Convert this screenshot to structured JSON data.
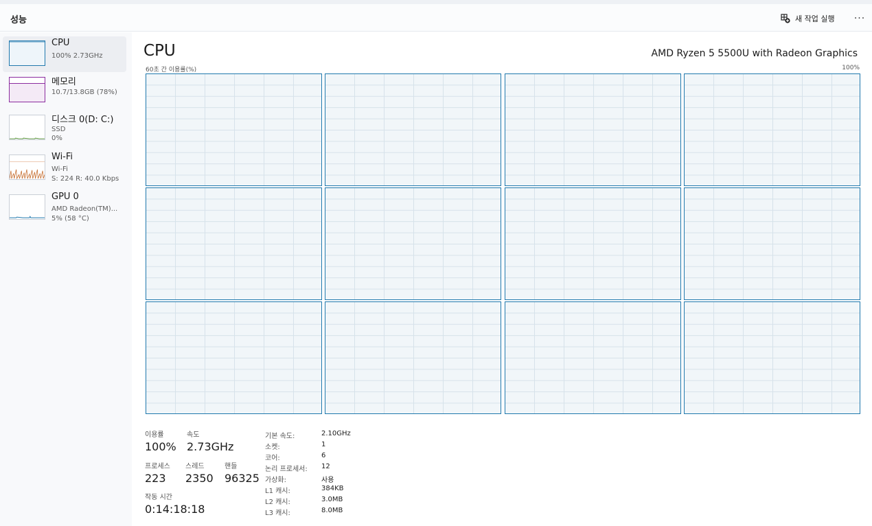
{
  "header": {
    "title": "성능",
    "new_task_label": "새 작업 실행",
    "more_label": "···"
  },
  "sidebar": {
    "items": [
      {
        "name": "CPU",
        "sub1": "100% 2.73GHz",
        "sub2": "",
        "sub3": "",
        "color": "#1f78ad",
        "icon": "cpu-graph"
      },
      {
        "name": "메모리",
        "sub1": "10.7/13.8GB (78%)",
        "sub2": "",
        "sub3": "",
        "color": "#8a2a9e",
        "icon": "memory-graph"
      },
      {
        "name": "디스크 0(D: C:)",
        "sub1": "SSD",
        "sub2": "0%",
        "sub3": "",
        "color": "#4c8c2c",
        "icon": "disk-graph"
      },
      {
        "name": "Wi-Fi",
        "sub1": "Wi-Fi",
        "sub2": "S: 224  R: 40.0 Kbps",
        "sub3": "",
        "color": "#c46a2a",
        "icon": "wifi-graph"
      },
      {
        "name": "GPU 0",
        "sub1": "AMD Radeon(TM)...",
        "sub2": "5% (58 °C)",
        "sub3": "",
        "color": "#1f78ad",
        "icon": "gpu-graph"
      }
    ]
  },
  "main": {
    "title": "CPU",
    "model": "AMD Ryzen 5 5500U with Radeon Graphics",
    "graph_caption": "60초 간 이용률(%)",
    "graph_max": "100%",
    "core_graph_count": 12
  },
  "stats": {
    "utilization_label": "이용률",
    "utilization_value": "100%",
    "speed_label": "속도",
    "speed_value": "2.73GHz",
    "processes_label": "프로세스",
    "processes_value": "223",
    "threads_label": "스레드",
    "threads_value": "2350",
    "handles_label": "핸들",
    "handles_value": "96325",
    "uptime_label": "작동 시간",
    "uptime_value": "0:14:18:18"
  },
  "details": [
    {
      "key": "기본 속도:",
      "value": "2.10GHz"
    },
    {
      "key": "소켓:",
      "value": "1"
    },
    {
      "key": "코어:",
      "value": "6"
    },
    {
      "key": "논리 프로세서:",
      "value": "12"
    },
    {
      "key": "가상화:",
      "value": "사용"
    },
    {
      "key": "L1 캐시:",
      "value": "384KB"
    },
    {
      "key": "L2 캐시:",
      "value": "3.0MB"
    },
    {
      "key": "L3 캐시:",
      "value": "8.0MB"
    }
  ]
}
